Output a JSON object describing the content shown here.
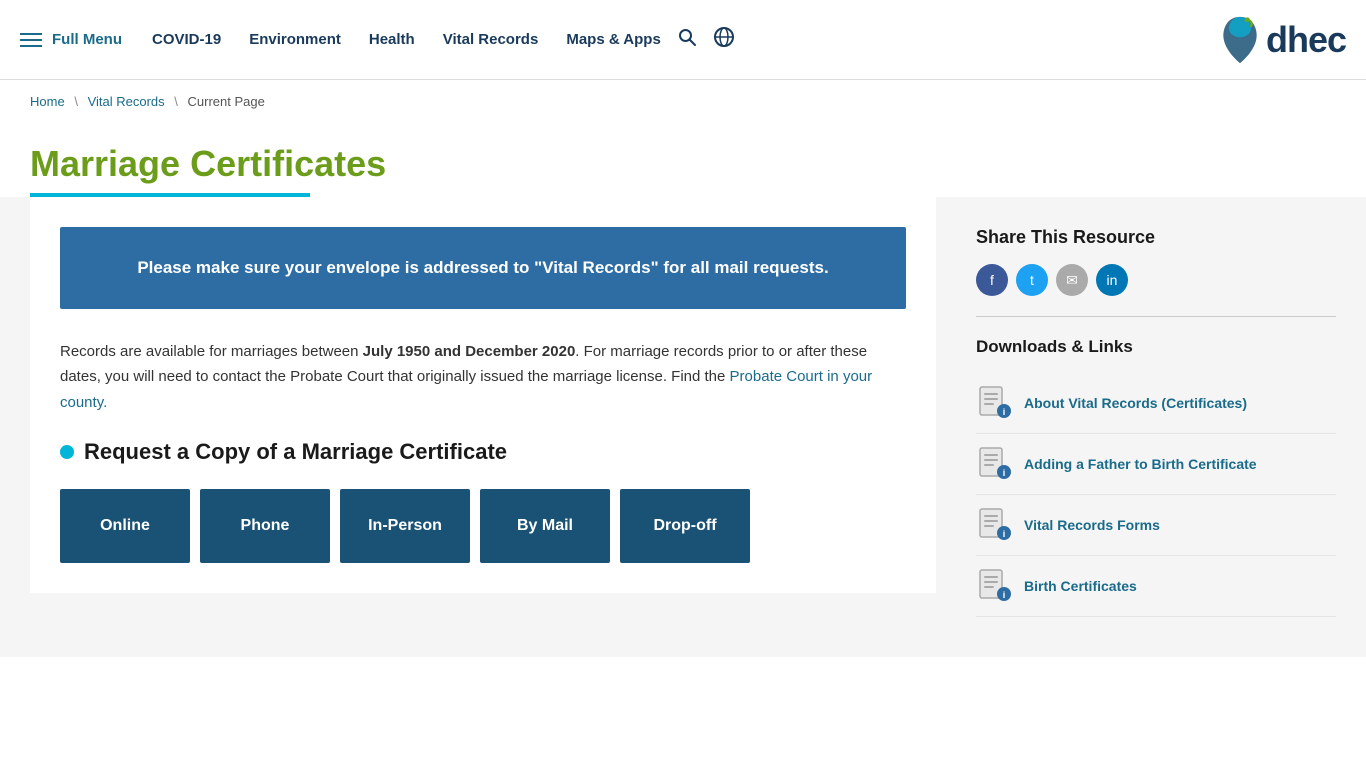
{
  "nav": {
    "hamburger_label": "≡",
    "full_menu": "Full Menu",
    "links": [
      {
        "label": "COVID-19",
        "id": "covid19"
      },
      {
        "label": "Environment",
        "id": "environment"
      },
      {
        "label": "Health",
        "id": "health"
      },
      {
        "label": "Vital Records",
        "id": "vital-records"
      },
      {
        "label": "Maps & Apps",
        "id": "maps-apps"
      }
    ],
    "search_icon": "🔍",
    "globe_icon": "🌐"
  },
  "logo": {
    "wordmark": "dhec"
  },
  "breadcrumb": {
    "home": "Home",
    "vital_records": "Vital Records",
    "current": "Current Page"
  },
  "page": {
    "title": "Marriage Certificates"
  },
  "alert": {
    "text": "Please make sure your envelope is addressed to \"Vital Records\" for all mail requests."
  },
  "records_text": {
    "before": "Records are available for marriages between ",
    "date_range": "July 1950 and December 2020",
    "after": ". For marriage records prior to or after these dates, you will need to contact the Probate Court that originally issued the marriage license. Find the ",
    "link_text": "Probate Court in your county.",
    "link_end": ""
  },
  "section": {
    "heading": "Request a Copy of a Marriage Certificate"
  },
  "buttons": [
    {
      "label": "Online",
      "id": "online"
    },
    {
      "label": "Phone",
      "id": "phone"
    },
    {
      "label": "In-Person",
      "id": "in-person"
    },
    {
      "label": "By Mail",
      "id": "by-mail"
    },
    {
      "label": "Drop-off",
      "id": "drop-off"
    }
  ],
  "sidebar": {
    "share_title": "Share This Resource",
    "downloads_title": "Downloads & Links",
    "items": [
      {
        "label": "About Vital Records (Certificates)",
        "id": "about-vital-records"
      },
      {
        "label": "Adding a Father to Birth Certificate",
        "id": "adding-father"
      },
      {
        "label": "Vital Records Forms",
        "id": "vital-records-forms"
      },
      {
        "label": "Birth Certificates",
        "id": "birth-certificates"
      }
    ]
  }
}
